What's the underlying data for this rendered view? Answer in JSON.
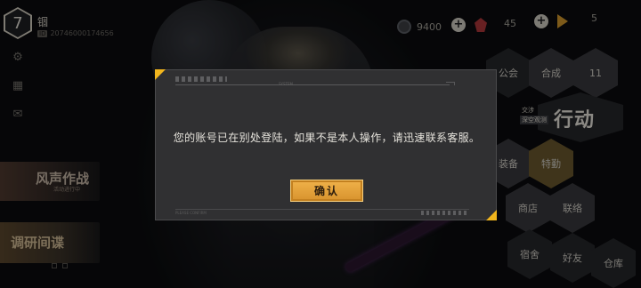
{
  "player": {
    "level": "7",
    "name": "锢",
    "uid_tag": "ID",
    "uid": "20746000174656"
  },
  "sidebar": {
    "icons": [
      "settings-icon",
      "calendar-icon",
      "mail-icon"
    ]
  },
  "events": {
    "banner1_title": "风声作战",
    "banner1_sub": "活动进行中",
    "banner2_title": "调研间谍"
  },
  "currency": {
    "value1": "9400",
    "value2": "45",
    "value3": "5"
  },
  "menu": {
    "hex_top_1": "",
    "hex_top_2": "合成",
    "hex_top_3": "11",
    "hex_left": "公会",
    "action_sub1": "交涉",
    "action_sub2": "深空观测",
    "action_title": "行动",
    "hex_mid_1": "装备",
    "hex_mid_2": "特勤",
    "hex_bot_1": "商店",
    "hex_bot_2": "联络",
    "hex_bot_3": "好友",
    "hex_bot_4": "仓库",
    "hex_bot_5": "宿舍"
  },
  "dialog": {
    "tiny_top": "SYSTEM",
    "message": "您的账号已在别处登陆，如果不是本人操作，请迅速联系客服。",
    "confirm_label": "确认",
    "tiny_bottom": "PLEASE CONFIRM"
  },
  "colors": {
    "accent": "#f1b51d",
    "button": "#e3a23a",
    "dialog_bg": "#303032"
  }
}
